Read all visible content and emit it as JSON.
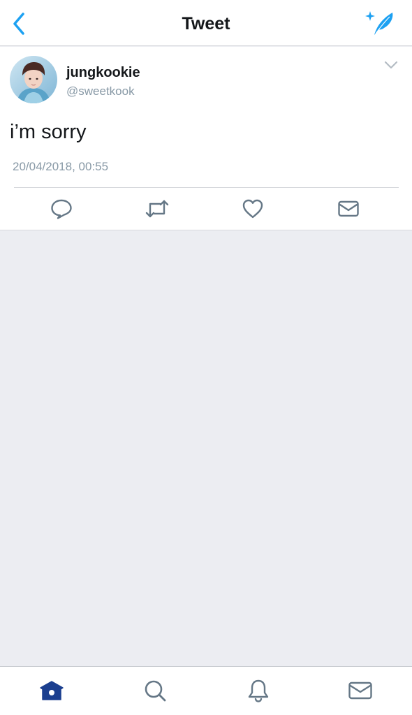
{
  "header": {
    "title": "Tweet",
    "back_icon": "chevron-left-icon",
    "compose_icon": "compose-feather-icon"
  },
  "tweet": {
    "display_name": "jungkookie",
    "handle": "@sweetkook",
    "text": "i’m sorry",
    "timestamp": "20/04/2018, 00:55",
    "menu_icon": "chevron-down-icon"
  },
  "actions": [
    {
      "name": "reply",
      "icon": "reply-icon"
    },
    {
      "name": "retweet",
      "icon": "retweet-icon"
    },
    {
      "name": "like",
      "icon": "heart-icon"
    },
    {
      "name": "direct-message",
      "icon": "envelope-icon"
    }
  ],
  "tabs": [
    {
      "name": "home",
      "icon": "home-icon",
      "active": true
    },
    {
      "name": "search",
      "icon": "search-icon",
      "active": false
    },
    {
      "name": "notifications",
      "icon": "bell-icon",
      "active": false
    },
    {
      "name": "messages",
      "icon": "envelope-icon",
      "active": false
    }
  ],
  "colors": {
    "accent": "#1da1f2",
    "active_tab": "#1b3f8f",
    "icon_gray": "#657786",
    "secondary_text": "#8899a6",
    "background": "#ecedf2"
  }
}
